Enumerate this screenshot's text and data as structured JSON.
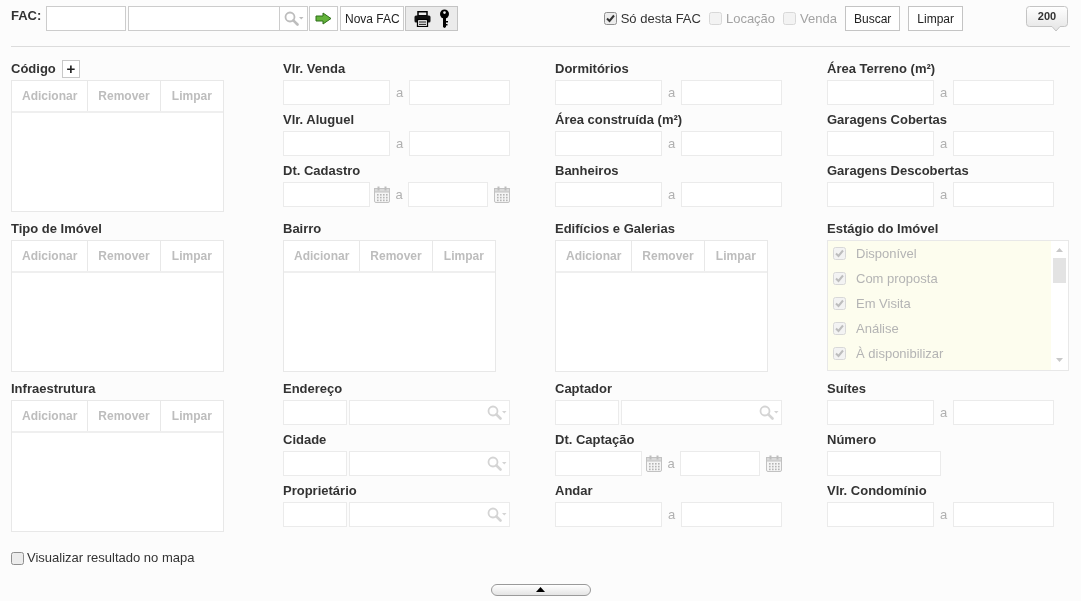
{
  "toolbar": {
    "label": "FAC:",
    "new_button": "Nova FAC",
    "filters": [
      {
        "label": "Só desta FAC",
        "checked": true,
        "disabled": false
      },
      {
        "label": "Locação",
        "checked": false,
        "disabled": true
      },
      {
        "label": "Venda",
        "checked": false,
        "disabled": true
      }
    ],
    "buttons": [
      "Buscar",
      "Limpar"
    ],
    "count_badge": "200"
  },
  "rows": [
    {
      "columns": [
        [
          {
            "kind": "list",
            "label": "Código",
            "add_button": "+",
            "buttons": [
              "Adicionar",
              "Remover",
              "Limpar"
            ]
          }
        ],
        [
          {
            "kind": "range",
            "label": "Vlr. Venda",
            "separator": "a"
          },
          {
            "kind": "range",
            "label": "Vlr. Aluguel",
            "separator": "a"
          },
          {
            "kind": "date_range",
            "label": "Dt. Cadastro",
            "separator": "a"
          }
        ],
        [
          {
            "kind": "range",
            "label": "Dormitórios",
            "separator": "a"
          },
          {
            "kind": "range",
            "label": "Área construída (m²)",
            "separator": "a"
          },
          {
            "kind": "range",
            "label": "Banheiros",
            "separator": "a"
          }
        ],
        [
          {
            "kind": "range",
            "label": "Área Terreno (m²)",
            "separator": "a"
          },
          {
            "kind": "range",
            "label": "Garagens Cobertas",
            "separator": "a"
          },
          {
            "kind": "range",
            "label": "Garagens Descobertas",
            "separator": "a"
          }
        ]
      ]
    },
    {
      "columns": [
        [
          {
            "kind": "list",
            "label": "Tipo de Imóvel",
            "buttons": [
              "Adicionar",
              "Remover",
              "Limpar"
            ]
          }
        ],
        [
          {
            "kind": "list",
            "label": "Bairro",
            "buttons": [
              "Adicionar",
              "Remover",
              "Limpar"
            ]
          }
        ],
        [
          {
            "kind": "list",
            "label": "Edifícios e Galerias",
            "buttons": [
              "Adicionar",
              "Remover",
              "Limpar"
            ]
          }
        ],
        [
          {
            "kind": "checklist",
            "label": "Estágio do Imóvel",
            "items": [
              {
                "label": "Disponível",
                "checked": true,
                "disabled": true
              },
              {
                "label": "Com proposta",
                "checked": true,
                "disabled": true
              },
              {
                "label": "Em Visita",
                "checked": true,
                "disabled": true
              },
              {
                "label": "Análise",
                "checked": true,
                "disabled": true
              },
              {
                "label": "À disponibilizar",
                "checked": true,
                "disabled": true
              }
            ]
          }
        ]
      ]
    },
    {
      "columns": [
        [
          {
            "kind": "list",
            "label": "Infraestrutura",
            "buttons": [
              "Adicionar",
              "Remover",
              "Limpar"
            ]
          }
        ],
        [
          {
            "kind": "lookup",
            "label": "Endereço"
          },
          {
            "kind": "lookup",
            "label": "Cidade"
          },
          {
            "kind": "lookup",
            "label": "Proprietário"
          }
        ],
        [
          {
            "kind": "lookup",
            "label": "Captador"
          },
          {
            "kind": "date_range",
            "label": "Dt. Captação",
            "separator": "a"
          },
          {
            "kind": "range",
            "label": "Andar",
            "separator": "a"
          }
        ],
        [
          {
            "kind": "range",
            "label": "Suítes",
            "separator": "a"
          },
          {
            "kind": "single",
            "label": "Número"
          },
          {
            "kind": "range",
            "label": "Vlr. Condomínio",
            "separator": "a"
          }
        ]
      ]
    }
  ],
  "map_option": {
    "label": "Visualizar resultado no mapa",
    "checked": false
  }
}
